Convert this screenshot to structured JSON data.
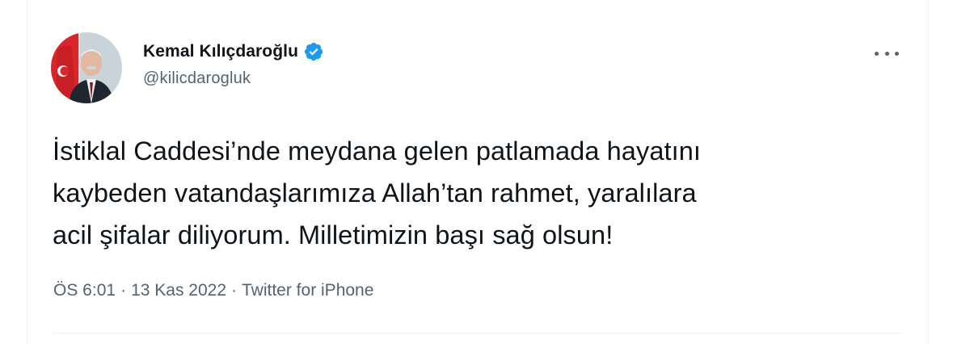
{
  "author": {
    "display_name": "Kemal Kılıçdaroğlu",
    "handle": "@kilicdarogluk",
    "verified": true
  },
  "tweet": {
    "text": "İstiklal Caddesi’nde meydana gelen patlamada hayatını\nkaybeden vatandaşlarımıza Allah’tan rahmet, yaralılara\nacil şifalar diliyorum. Milletimizin başı sağ olsun!"
  },
  "meta": {
    "time": "ÖS 6:01",
    "separator": "·",
    "date": "13 Kas 2022",
    "source": "Twitter for iPhone"
  },
  "colors": {
    "verified_badge": "#1d9bf0",
    "secondary_text": "#536471",
    "primary_text": "#0f1419"
  },
  "icons": {
    "verified": "verified-badge-icon",
    "more": "more-options-icon"
  }
}
